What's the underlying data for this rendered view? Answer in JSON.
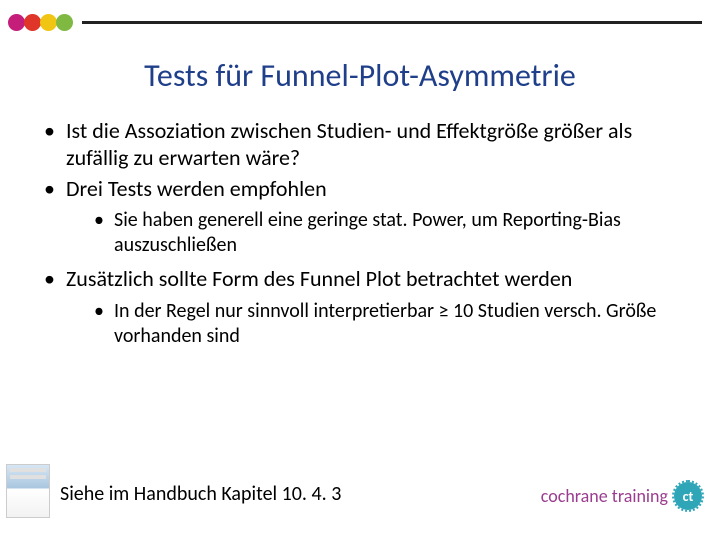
{
  "title": "Tests für Funnel-Plot-Asymmetrie",
  "bullets": {
    "b1": "Ist die Assoziation zwischen Studien- und Effektgröße größer als zufällig zu erwarten wäre?",
    "b2": "Drei Tests werden empfohlen",
    "b2a": "Sie haben generell eine geringe stat. Power, um Reporting-Bias auszuschließen",
    "b3": "Zusätzlich sollte Form des Funnel Plot betrachtet werden",
    "b3a": "In der Regel nur sinnvoll interpretierbar ≥ 10 Studien versch. Größe vorhanden sind"
  },
  "footnote": "Siehe im Handbuch Kapitel 10. 4. 3",
  "brand": {
    "text": "cochrane training",
    "logo_letter": "ct"
  },
  "colors": {
    "title": "#1f3f8a",
    "brand": "#9a3c8f",
    "logo_bg": "#2ea6b8"
  }
}
